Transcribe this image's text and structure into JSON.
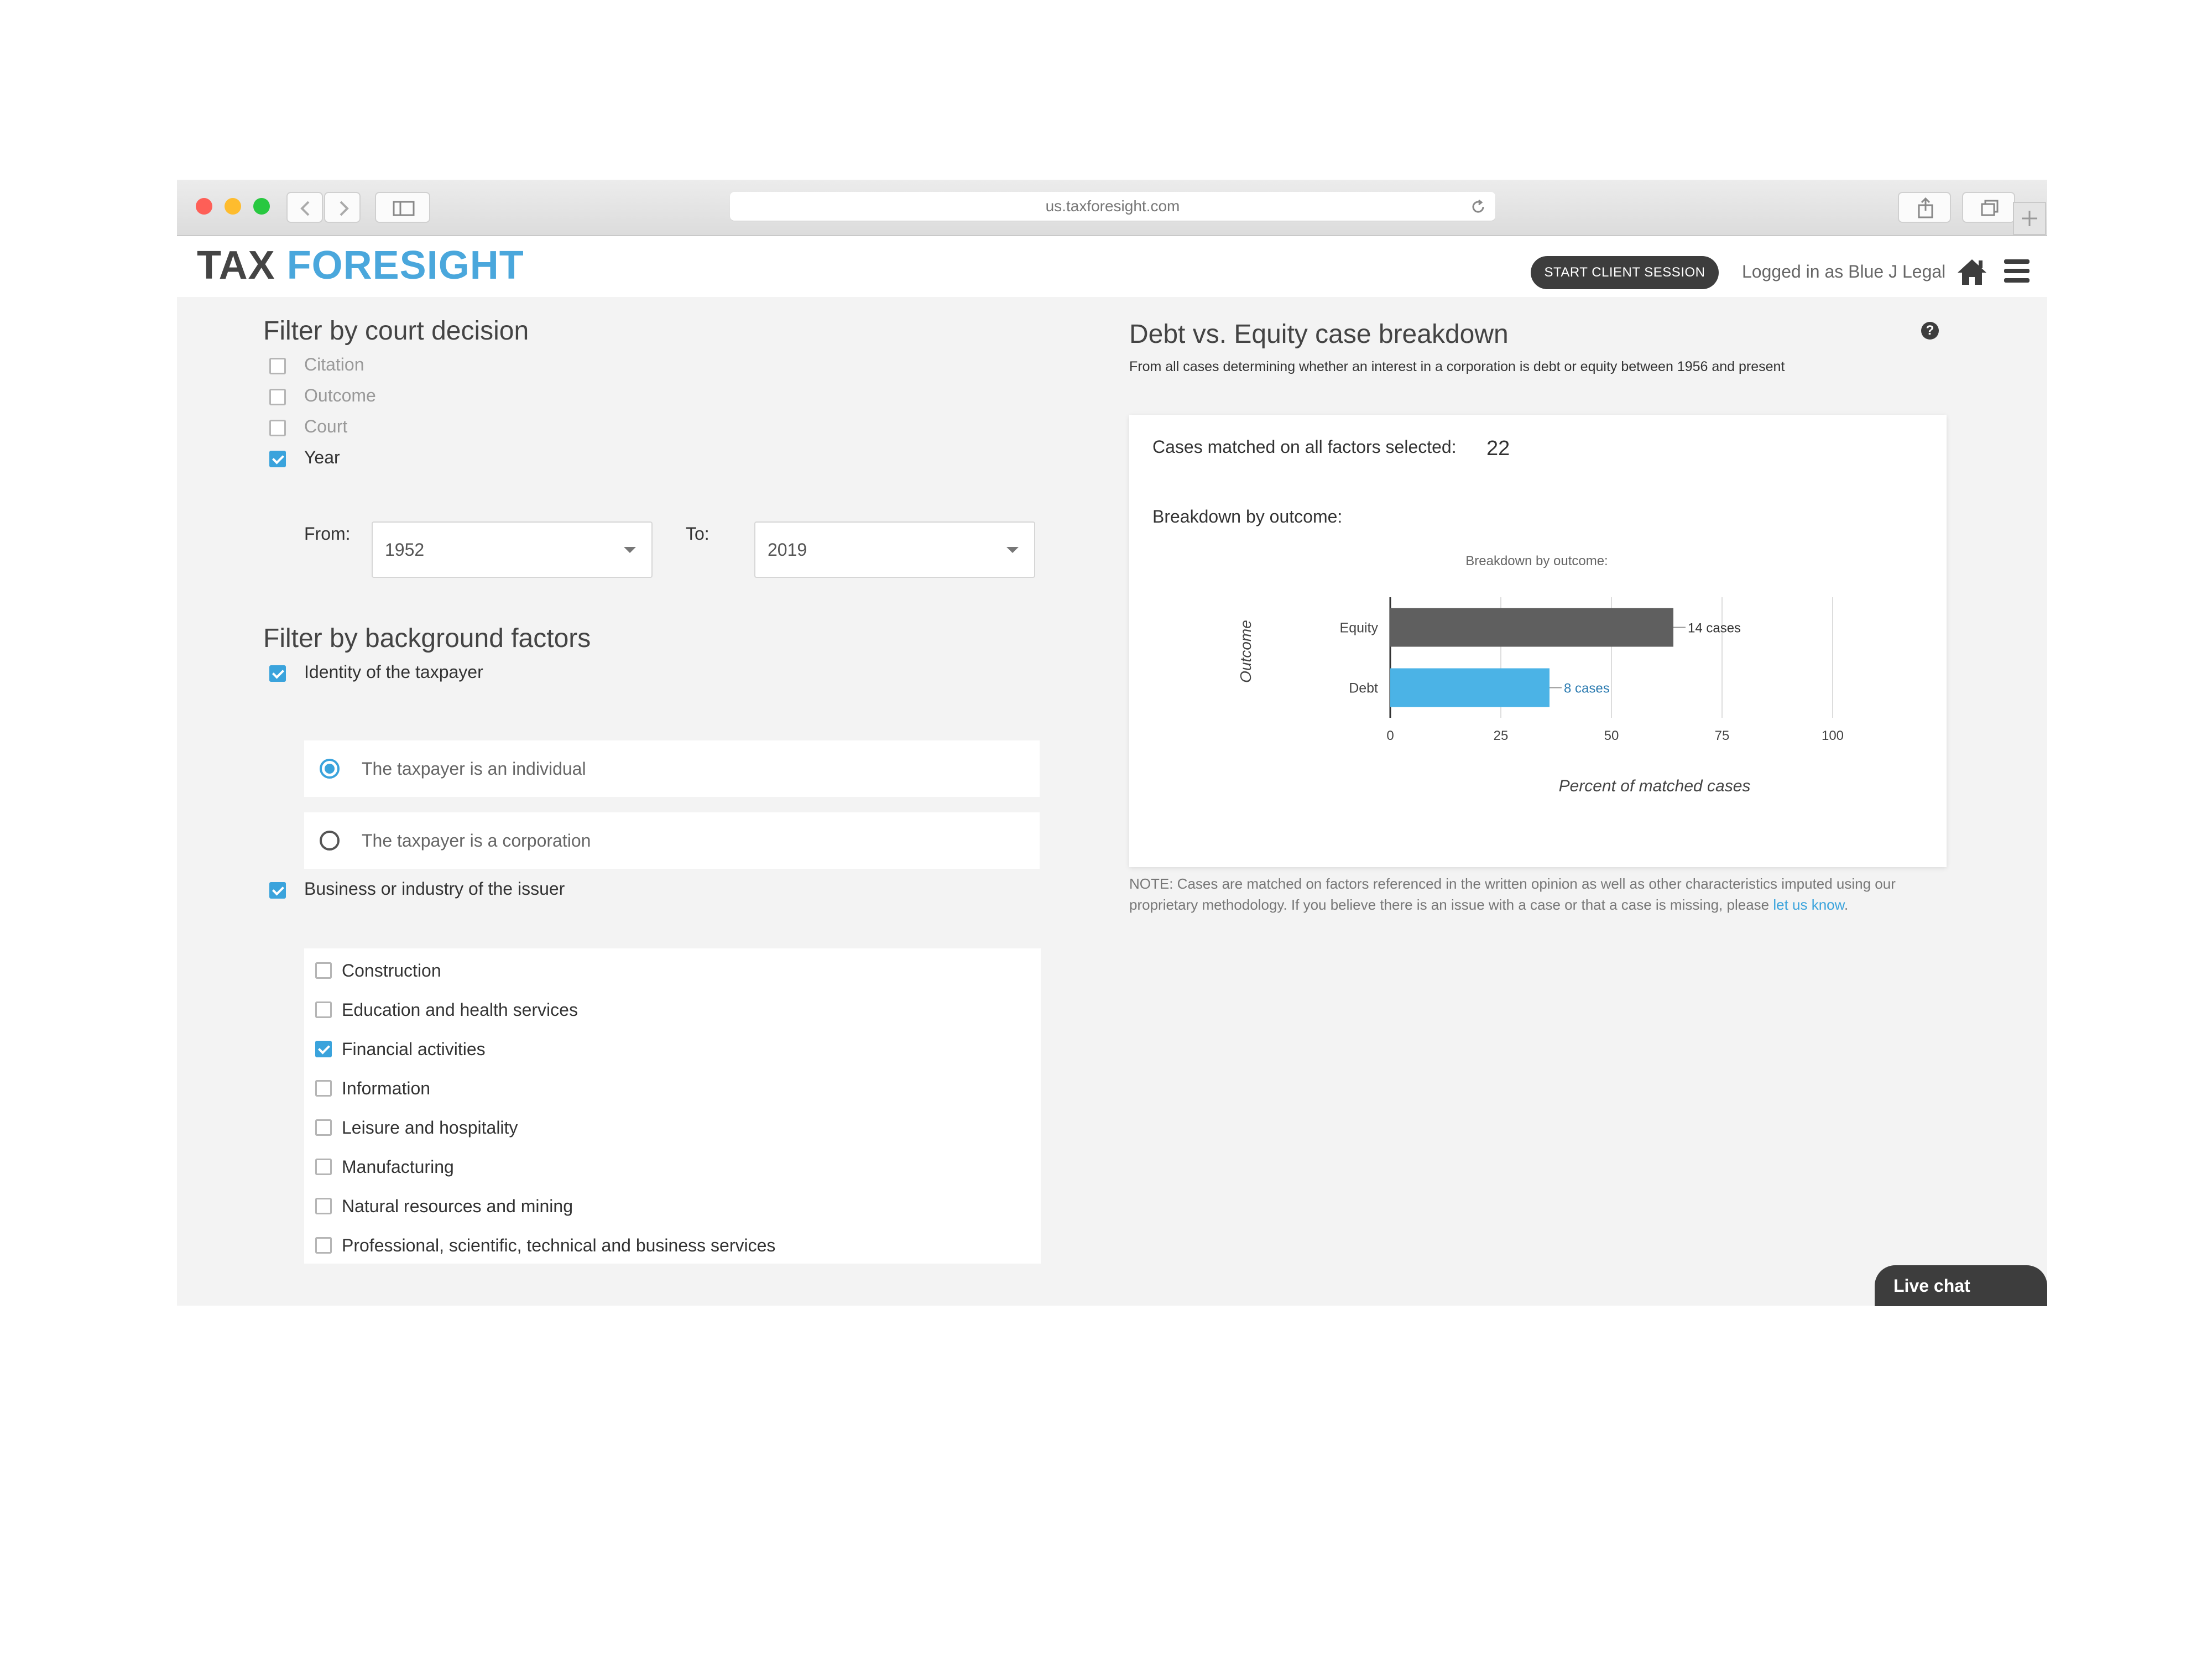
{
  "browser": {
    "url": "us.taxforesight.com",
    "traffic_lights": {
      "close": "#fe5f57",
      "minimize": "#febc2e",
      "maximize": "#28c840"
    }
  },
  "header": {
    "logo_part1": "TAX",
    "logo_part2": "FORESIGHT",
    "logo_color_dark": "#444444",
    "logo_color_accent": "#4aa7dc",
    "start_session_label": "START CLIENT SESSION",
    "logged_in_text": "Logged in as Blue J Legal",
    "home_icon": "home-icon",
    "menu_icon": "hamburger-menu-icon"
  },
  "court_filter": {
    "title": "Filter by court decision",
    "options": [
      {
        "label": "Citation",
        "checked": false
      },
      {
        "label": "Outcome",
        "checked": false
      },
      {
        "label": "Court",
        "checked": false
      },
      {
        "label": "Year",
        "checked": true
      }
    ],
    "from_label": "From:",
    "from_value": "1952",
    "to_label": "To:",
    "to_value": "2019"
  },
  "background_filter": {
    "title": "Filter by background factors",
    "identity": {
      "label": "Identity of the taxpayer",
      "checked": true,
      "options": [
        {
          "label": "The taxpayer is an individual",
          "selected": true
        },
        {
          "label": "The taxpayer is a corporation",
          "selected": false
        }
      ]
    },
    "business": {
      "label": "Business or industry of the issuer",
      "checked": true,
      "options": [
        {
          "label": "Construction",
          "checked": false
        },
        {
          "label": "Education and health services",
          "checked": false
        },
        {
          "label": "Financial activities",
          "checked": true
        },
        {
          "label": "Information",
          "checked": false
        },
        {
          "label": "Leisure and hospitality",
          "checked": false
        },
        {
          "label": "Manufacturing",
          "checked": false
        },
        {
          "label": "Natural resources and mining",
          "checked": false
        },
        {
          "label": "Professional, scientific, technical and business services",
          "checked": false
        }
      ]
    }
  },
  "breakdown": {
    "title": "Debt vs. Equity case breakdown",
    "subtitle": "From all cases determining whether an interest in a corporation is debt or equity between 1956 and present",
    "matched_label": "Cases matched on all factors selected:",
    "matched_count": "22",
    "outcome_heading": "Breakdown by outcome:",
    "note_text": "NOTE: Cases are matched on factors referenced in the written opinion as well as other characteristics imputed using our proprietary methodology. If you believe there is an issue with a case or that a case is missing, please ",
    "note_link": "let us know",
    "note_end": "."
  },
  "chart_data": {
    "type": "bar",
    "orientation": "horizontal",
    "title": "Breakdown by outcome:",
    "xlabel": "Percent of matched cases",
    "ylabel": "Outcome",
    "categories": [
      "Equity",
      "Debt"
    ],
    "values": [
      64,
      36
    ],
    "data_labels": [
      "14 cases",
      "8 cases"
    ],
    "colors": [
      "#5f5f5f",
      "#4bb3e6"
    ],
    "label_colors": [
      "#333333",
      "#2a7ab0"
    ],
    "xlim": [
      0,
      100
    ],
    "xticks": [
      "0",
      "25",
      "50",
      "75",
      "100"
    ],
    "grid": true
  },
  "live_chat_label": "Live chat"
}
